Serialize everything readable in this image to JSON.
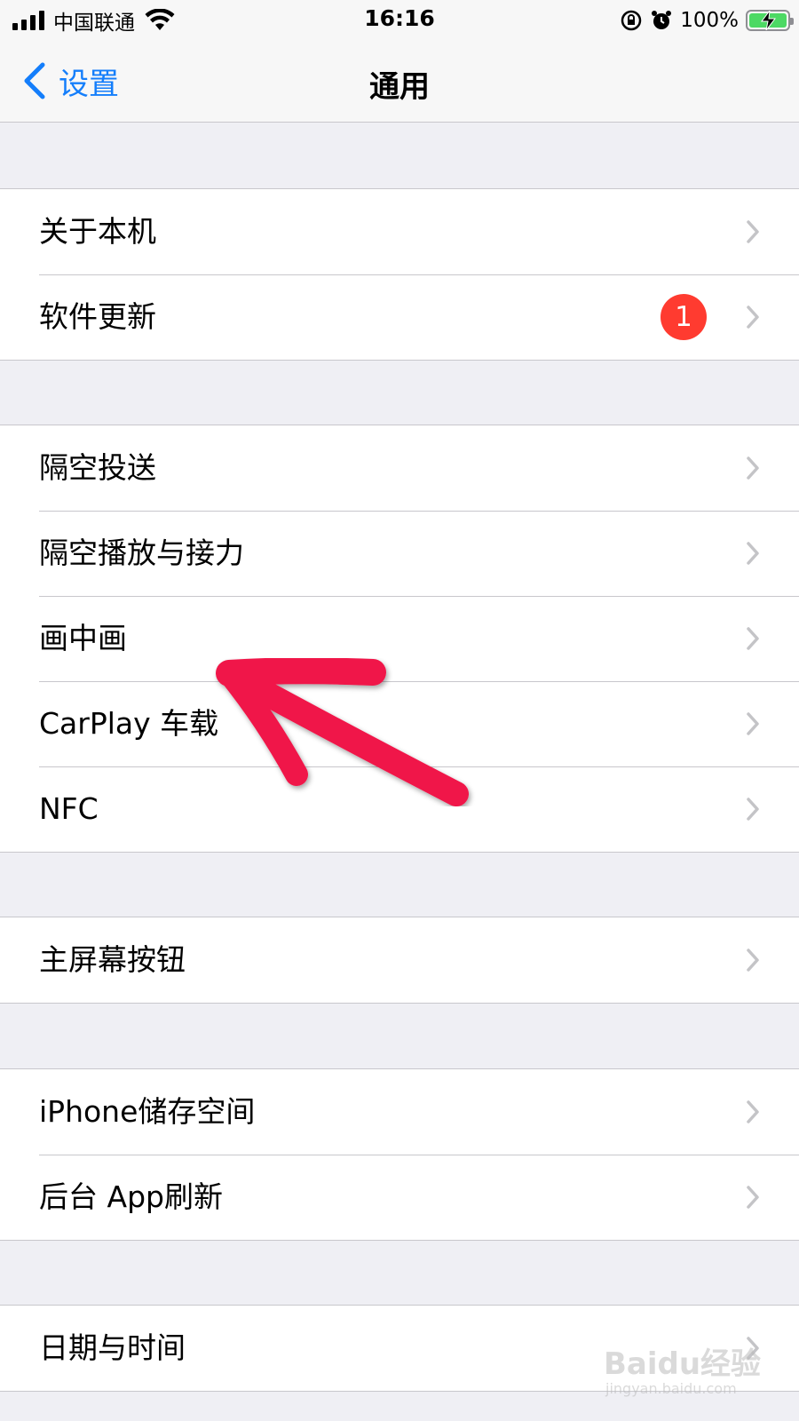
{
  "status_bar": {
    "carrier": "中国联通",
    "time": "16:16",
    "battery_percent": "100%",
    "battery_level": 1.0,
    "icons": [
      "signal-icon",
      "wifi-icon",
      "rotation-lock-icon",
      "alarm-icon",
      "battery-charging-icon"
    ]
  },
  "nav": {
    "back_label": "设置",
    "title": "通用"
  },
  "groups": [
    {
      "items": [
        {
          "label": "关于本机"
        },
        {
          "label": "软件更新",
          "badge": "1"
        }
      ]
    },
    {
      "items": [
        {
          "label": "隔空投送"
        },
        {
          "label": "隔空播放与接力"
        },
        {
          "label": "画中画"
        },
        {
          "label": "CarPlay 车载"
        },
        {
          "label": "NFC"
        }
      ]
    },
    {
      "items": [
        {
          "label": "主屏幕按钮"
        }
      ]
    },
    {
      "items": [
        {
          "label": "iPhone储存空间"
        },
        {
          "label": "后台 App刷新"
        }
      ]
    },
    {
      "items": [
        {
          "label": "日期与时间"
        }
      ]
    }
  ],
  "colors": {
    "accent": "#147efb",
    "badge": "#ff3b30",
    "annotation_arrow": "#f0194a",
    "battery": "#4cd964"
  },
  "watermark": {
    "brand": "Baidu经验",
    "sub": "jingyan.baidu.com"
  }
}
